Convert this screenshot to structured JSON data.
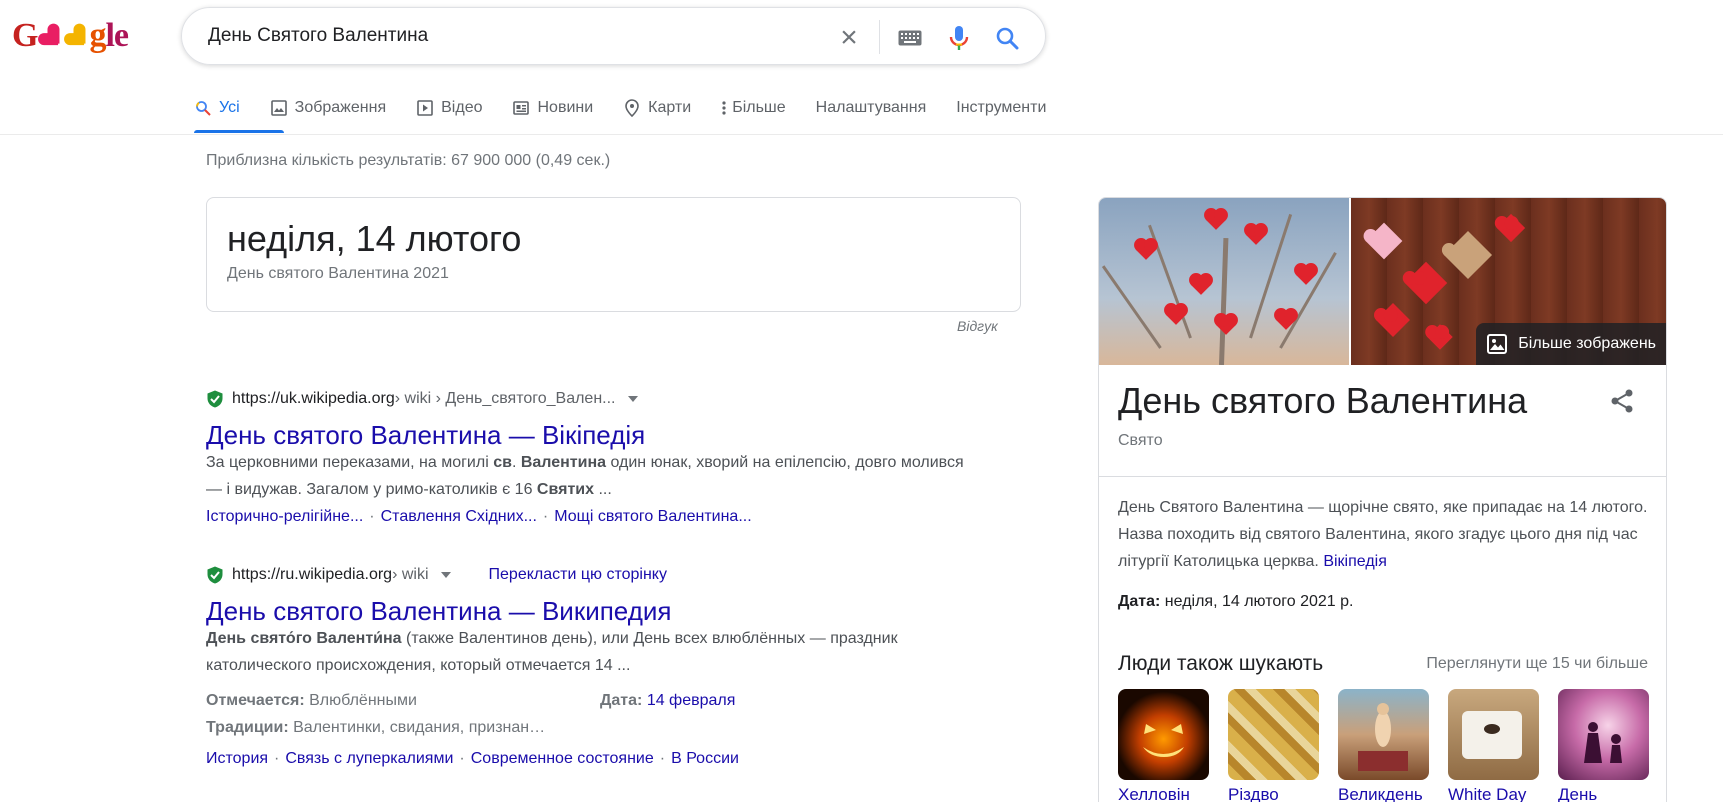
{
  "colors": {
    "link": "#1a0dab",
    "accent": "#1a73e8",
    "verified": "#1e8e3e"
  },
  "header": {
    "logo_text": "Google",
    "search": {
      "value": "День Святого Валентина"
    },
    "icons": [
      "close-icon",
      "keyboard-icon",
      "mic-icon",
      "search-icon"
    ]
  },
  "tabs": [
    {
      "label": "Усі",
      "icon": "search-icon",
      "active": true
    },
    {
      "label": "Зображення",
      "icon": "image-icon"
    },
    {
      "label": "Відео",
      "icon": "video-icon"
    },
    {
      "label": "Новини",
      "icon": "news-icon"
    },
    {
      "label": "Карти",
      "icon": "map-pin-icon"
    },
    {
      "label": "Більше",
      "icon": "more-vertical-icon"
    },
    {
      "label": "Налаштування"
    },
    {
      "label": "Інструменти"
    }
  ],
  "stats": "Приблизна кількість результатів: 67 900 000 (0,49 сек.)",
  "answer": {
    "date": "неділя, 14 лютого",
    "subtitle": "День святого Валентина 2021",
    "feedback": "Відгук"
  },
  "results": [
    {
      "domain": "https://uk.wikipedia.org",
      "path": " › wiki › День_святого_Вален...",
      "title": "День святого Валентина — Вікіпедія",
      "snippet_parts": {
        "a": "За церковними переказами, на могилі ",
        "b1": "св",
        "c": ". ",
        "b2": "Валентина",
        "d": " один юнак, хворий на епілепсію, довго молився — і видужав. Загалом у римо-католиків є 16 ",
        "b3": "Святих",
        "e": " ..."
      },
      "sitelinks": [
        "Історично-релігійне...",
        "Ставлення Східних...",
        "Мощі святого Валентина..."
      ]
    },
    {
      "domain": "https://ru.wikipedia.org",
      "path": " › wiki",
      "translate": "Перекласти цю сторінку",
      "title": "День святого Валентина — Википедия",
      "snippet_parts": {
        "b1": "День свято́го Валенти́на",
        "a": " (также Валентинов день), или День всех влюблённых — праздник католического происхождения, который отмечается 14 ..."
      },
      "facts": {
        "celebrated_label": "Отмечается:",
        "celebrated_value": " Влюблёнными",
        "date_label": "Дата:",
        "date_value": "14 февраля",
        "traditions_label": "Традиции:",
        "traditions_value": " Валентинки, свидания, признан…"
      },
      "sitelinks": [
        "История",
        "Связь с луперкалиями",
        "Современное состояние",
        "В России"
      ]
    }
  ],
  "knowledge_panel": {
    "more_images": "Більше зображень",
    "title": "День святого Валентина",
    "type": "Свято",
    "description": "День Святого Валентина — щорічне свято, яке припадає на 14 лютого. Назва походить від святого Валентина, якого згадує цього дня під час літургії Католицька церква. ",
    "description_link": "Вікіпедія",
    "date_label": "Дата:",
    "date_value": " неділя, 14 лютого 2021 р.",
    "people_heading": "Люди також шукають",
    "people_more": "Переглянути ще 15 чи більше",
    "people": [
      {
        "label": "Хелловін"
      },
      {
        "label": "Різдво"
      },
      {
        "label": "Великдень"
      },
      {
        "label": "White Day"
      },
      {
        "label": "День"
      }
    ]
  }
}
